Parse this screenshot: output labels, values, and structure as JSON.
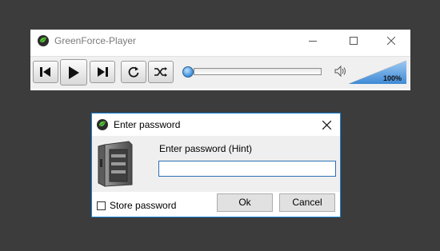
{
  "player": {
    "title": "GreenForce-Player",
    "volume": {
      "label": "100%",
      "level": 1.0
    },
    "seek": {
      "position": 0.0
    },
    "icons": {
      "app": "greenforce-logo-icon",
      "minimize": "minimize-icon",
      "maximize": "maximize-icon",
      "close": "close-icon",
      "previous": "previous-icon",
      "play": "play-icon",
      "next": "next-icon",
      "repeat": "repeat-icon",
      "shuffle": "shuffle-icon",
      "speaker": "speaker-icon"
    }
  },
  "dialog": {
    "title": "Enter password",
    "prompt": "Enter password (Hint)",
    "password_value": "",
    "store_password_label": "Store password",
    "store_password_checked": false,
    "ok_label": "Ok",
    "cancel_label": "Cancel",
    "icons": {
      "app": "greenforce-logo-icon",
      "safe": "safe-icon",
      "close": "close-icon"
    }
  },
  "colors": {
    "desktop": "#3c3c3c",
    "accent_border": "#1883d7",
    "volume_fill": "#4a93dd",
    "seek_knob": "#3b8fd9"
  }
}
